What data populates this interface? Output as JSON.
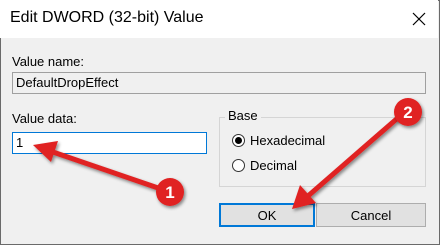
{
  "window": {
    "title": "Edit DWORD (32-bit) Value"
  },
  "value_name": {
    "label": "Value name:",
    "value": "DefaultDropEffect"
  },
  "value_data": {
    "label": "Value data:",
    "value": "1"
  },
  "base": {
    "label": "Base",
    "options": [
      {
        "label": "Hexadecimal",
        "selected": true
      },
      {
        "label": "Decimal",
        "selected": false
      }
    ]
  },
  "buttons": {
    "ok": "OK",
    "cancel": "Cancel"
  },
  "annotations": {
    "color": "#e02020",
    "markers": [
      {
        "number": "1"
      },
      {
        "number": "2"
      }
    ]
  },
  "icons": {
    "close": "close-icon"
  }
}
